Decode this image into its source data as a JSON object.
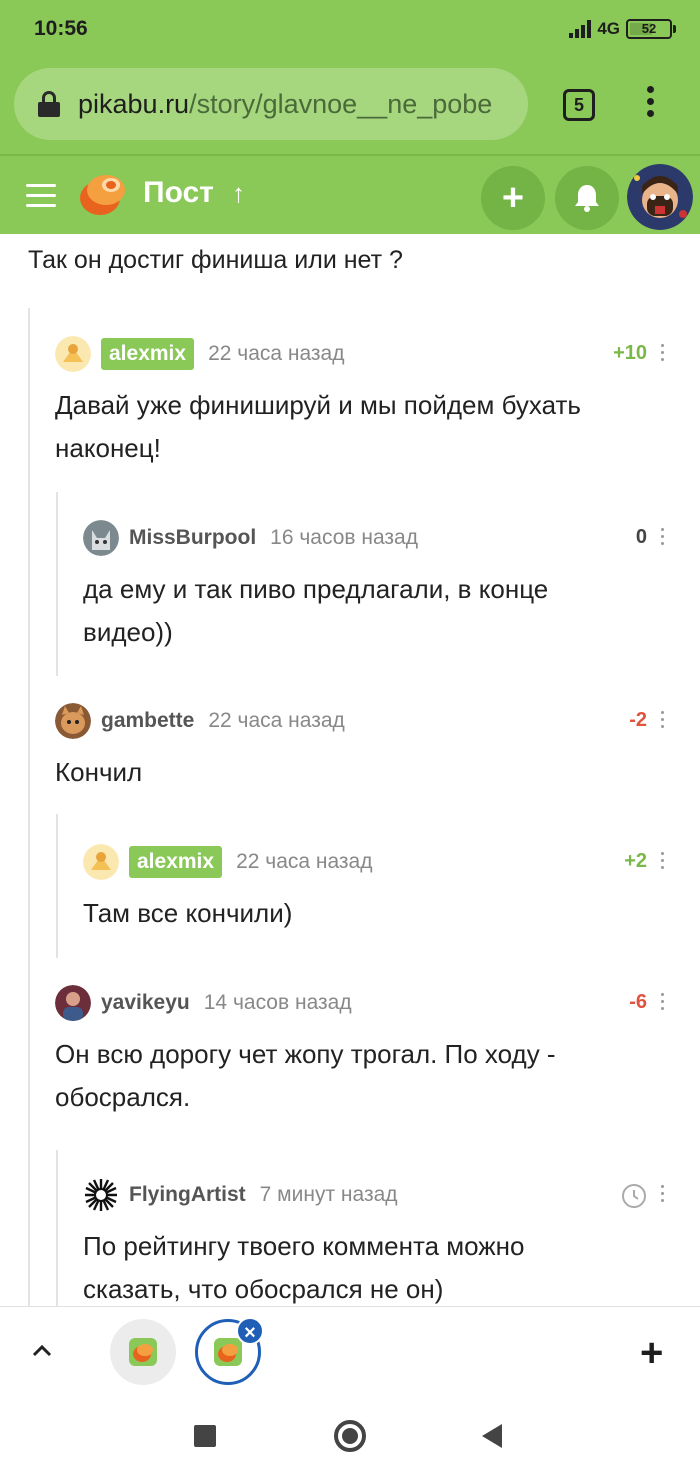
{
  "status_bar": {
    "time": "10:56",
    "network": "4G",
    "battery": "52"
  },
  "browser": {
    "url_domain": "pikabu.ru",
    "url_path": "/story/glavnoe__ne_pobe",
    "tab_count": "5"
  },
  "site_header": {
    "title": "Пост",
    "up_symbol": "↑",
    "add_symbol": "+"
  },
  "content": {
    "top_text": "Так он достиг финиша или нет ?",
    "comments": [
      {
        "author": "alexmix",
        "author_badge": true,
        "time": "22 часа назад",
        "rating": "+10",
        "text_lines": [
          "Давай уже финишируй и мы пойдем бухать",
          "наконец!"
        ]
      },
      {
        "author": "MissBurpool",
        "author_badge": false,
        "time": "16 часов назад",
        "rating": "0",
        "text_lines": [
          "да ему и так пиво предлагали, в конце",
          "видео))"
        ]
      },
      {
        "author": "gambette",
        "author_badge": false,
        "time": "22 часа назад",
        "rating": "-2",
        "text_lines": [
          "Кончил"
        ]
      },
      {
        "author": "alexmix",
        "author_badge": true,
        "time": "22 часа назад",
        "rating": "+2",
        "text_lines": [
          "Там все кончили)"
        ]
      },
      {
        "author": "yavikeyu",
        "author_badge": false,
        "time": "14 часов назад",
        "rating": "-6",
        "text_lines": [
          "Он всю дорогу чет жопу трогал. По ходу -",
          "обосрался."
        ]
      },
      {
        "author": "FlyingArtist",
        "author_badge": false,
        "time": "7 минут назад",
        "rating": "",
        "text_lines": [
          "По рейтингу твоего коммента можно",
          "сказать, что обосрался не он)"
        ]
      }
    ]
  },
  "tab_bar": {
    "close_symbol": "×",
    "new_tab_symbol": "+"
  },
  "colors": {
    "brand_green": "#8ac858",
    "positive": "#7ab848",
    "negative": "#e0533f",
    "active_tab": "#1f5fb8"
  }
}
